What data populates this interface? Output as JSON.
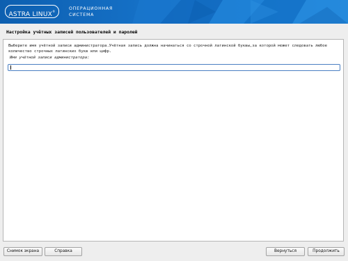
{
  "header": {
    "logo_text": "ASTRA LINUX",
    "logo_mark": "®",
    "tagline_line1": "ОПЕРАЦИОННАЯ",
    "tagline_line2": "СИСТЕМА",
    "colors": {
      "banner": "#1570c6",
      "text": "#ffffff"
    }
  },
  "section": {
    "title": "Настройка учётных записей пользователей и паролей"
  },
  "main": {
    "description": "Выберите имя учётной записи администратора.Учётная запись должна начинаться со строчной латинской буквы,за которой может следовать любое количество строчных латинских букв или цифр.",
    "field_label": "Имя учётной записи администратора:",
    "field_value": ""
  },
  "buttons": {
    "screenshot": "Снимок экрана",
    "help": "Справка",
    "back": "Вернуться",
    "continue": "Продолжить"
  }
}
